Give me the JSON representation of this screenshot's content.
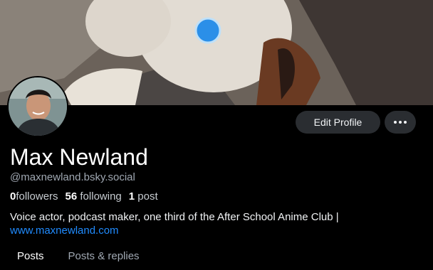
{
  "profile": {
    "display_name": "Max Newland",
    "handle": "@maxnewland.bsky.social",
    "followers_count": "0",
    "followers_label": "followers",
    "following_count": "56",
    "following_label": "following",
    "posts_count": "1",
    "posts_label": "post",
    "bio_text": "Voice actor, podcast maker, one third of the After School Anime Club |",
    "bio_link": "www.maxnewland.com"
  },
  "actions": {
    "edit_label": "Edit Profile",
    "more_icon": "ellipsis-icon"
  },
  "tabs": [
    {
      "label": "Posts",
      "active": true
    },
    {
      "label": "Posts & replies",
      "active": false
    }
  ],
  "colors": {
    "background": "#000000",
    "button_bg": "#2a2d31",
    "link": "#208bfe",
    "muted_text": "#a0a8b2"
  }
}
